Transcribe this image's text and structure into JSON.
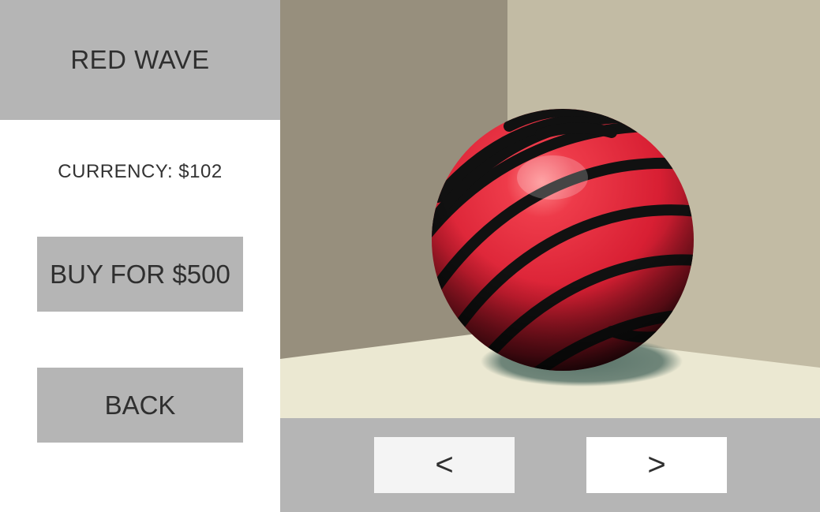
{
  "skin": {
    "name": "RED WAVE"
  },
  "shop": {
    "currency_label": "CURRENCY: $102",
    "buy_label": "BUY FOR $500",
    "back_label": "BACK"
  },
  "nav": {
    "prev_label": "<",
    "next_label": ">"
  },
  "colors": {
    "panel_gray": "#b5b5b5",
    "wall_left": "#978f7d",
    "wall_right": "#c2bba4",
    "floor": "#ebe8d2",
    "ball_red": "#e0283a",
    "ball_stripe": "#111111",
    "shadow": "#617a6f"
  }
}
